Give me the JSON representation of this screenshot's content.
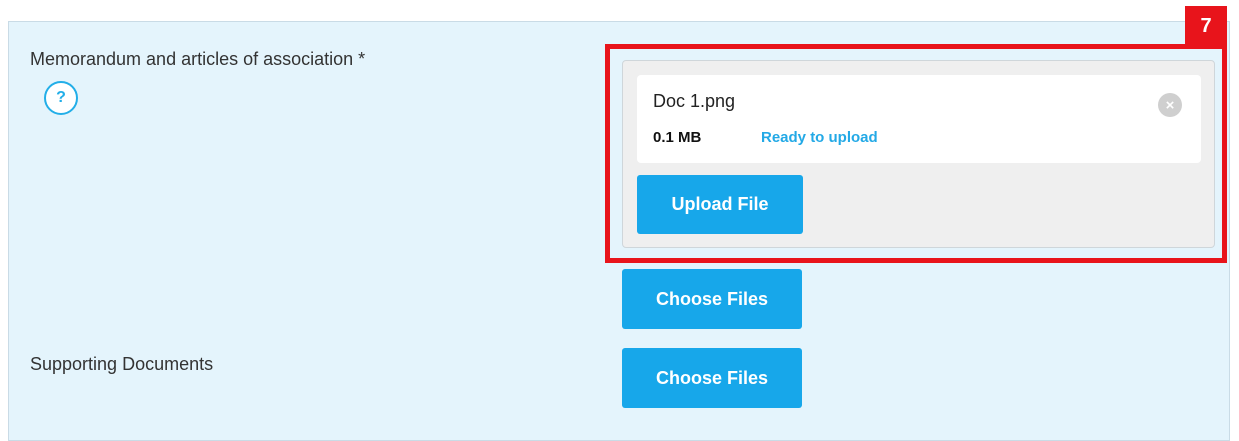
{
  "form": {
    "memorandum": {
      "label": "Memorandum and articles of association *",
      "help_icon": "?",
      "file": {
        "name": "Doc 1.png",
        "size": "0.1 MB",
        "status": "Ready to upload",
        "remove_icon": "×"
      },
      "upload_button": "Upload File",
      "choose_button": "Choose Files"
    },
    "supporting": {
      "label": "Supporting Documents",
      "choose_button": "Choose Files"
    }
  },
  "annotation": {
    "step": "7",
    "color": "#e8141b"
  },
  "colors": {
    "panel_background": "#e4f4fc",
    "accent": "#17a7ea",
    "status_text": "#23a9e6"
  }
}
